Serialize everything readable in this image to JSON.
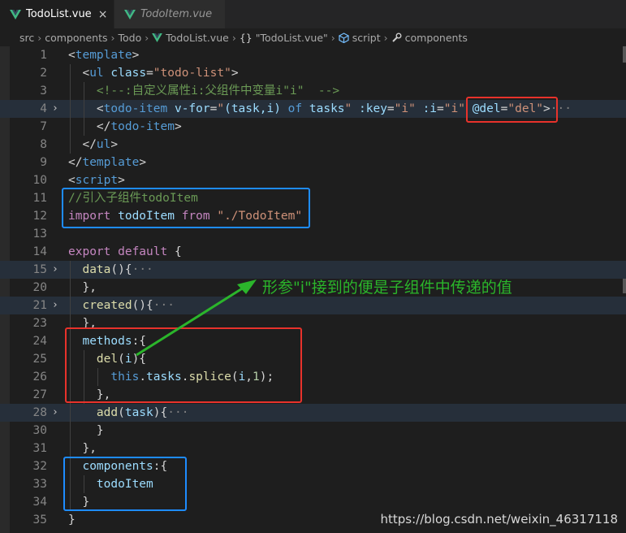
{
  "tabs": [
    {
      "label": "TodoList.vue",
      "close": "×"
    },
    {
      "label": "TodoItem.vue"
    }
  ],
  "breadcrumb": {
    "items": [
      "src",
      "components",
      "Todo",
      "TodoList.vue",
      "\"TodoList.vue\"",
      "script",
      "components"
    ],
    "brace": "{}"
  },
  "code_lines": [
    {
      "n": "1",
      "f": "",
      "tok": [
        [
          "t-pun",
          "<"
        ],
        [
          "t-tag",
          "template"
        ],
        [
          "t-pun",
          ">"
        ]
      ]
    },
    {
      "n": "2",
      "f": "",
      "tok": [
        [
          "t-pun",
          "  <"
        ],
        [
          "t-tag",
          "ul "
        ],
        [
          "t-attr",
          "class"
        ],
        [
          "t-pun",
          "="
        ],
        [
          "t-str",
          "\"todo-list\""
        ],
        [
          "t-pun",
          ">"
        ]
      ]
    },
    {
      "n": "3",
      "f": "",
      "tok": [
        [
          "t-com",
          "    <!--:自定义属性i:父组件中变量i\"i\"  -->"
        ]
      ]
    },
    {
      "n": "4",
      "f": "›",
      "hl": true,
      "tok": [
        [
          "t-pun",
          "    <"
        ],
        [
          "t-tag",
          "todo-item "
        ],
        [
          "t-attr",
          "v-for"
        ],
        [
          "t-pun",
          "="
        ],
        [
          "t-str",
          "\""
        ],
        [
          "t-var",
          "(task,i) "
        ],
        [
          "t-kw",
          "of "
        ],
        [
          "t-var",
          "tasks"
        ],
        [
          "t-str",
          "\" "
        ],
        [
          "t-attr",
          ":key"
        ],
        [
          "t-pun",
          "="
        ],
        [
          "t-str",
          "\"i\" "
        ],
        [
          "t-attr",
          ":i"
        ],
        [
          "t-pun",
          "="
        ],
        [
          "t-str",
          "\"i\" "
        ],
        [
          "t-attr",
          "@del"
        ],
        [
          "t-pun",
          "="
        ],
        [
          "t-str",
          "\"del\""
        ],
        [
          "t-pun",
          ">"
        ],
        [
          "t-gray",
          "···"
        ]
      ]
    },
    {
      "n": "7",
      "f": "",
      "tok": [
        [
          "t-pun",
          "    </"
        ],
        [
          "t-tag",
          "todo-item"
        ],
        [
          "t-pun",
          ">"
        ]
      ]
    },
    {
      "n": "8",
      "f": "",
      "tok": [
        [
          "t-pun",
          "  </"
        ],
        [
          "t-tag",
          "ul"
        ],
        [
          "t-pun",
          ">"
        ]
      ]
    },
    {
      "n": "9",
      "f": "",
      "tok": [
        [
          "t-pun",
          "</"
        ],
        [
          "t-tag",
          "template"
        ],
        [
          "t-pun",
          ">"
        ]
      ]
    },
    {
      "n": "10",
      "f": "",
      "tok": [
        [
          "t-pun",
          "<"
        ],
        [
          "t-tag",
          "script"
        ],
        [
          "t-pun",
          ">"
        ]
      ]
    },
    {
      "n": "11",
      "f": "",
      "tok": [
        [
          "t-com",
          "//引入子组件todoItem"
        ]
      ]
    },
    {
      "n": "12",
      "f": "",
      "tok": [
        [
          "t-kw2",
          "import "
        ],
        [
          "t-var",
          "todoItem "
        ],
        [
          "t-kw2",
          "from "
        ],
        [
          "t-str",
          "\"./TodoItem\""
        ]
      ]
    },
    {
      "n": "13",
      "f": "",
      "tok": []
    },
    {
      "n": "14",
      "f": "",
      "tok": [
        [
          "t-kw2",
          "export "
        ],
        [
          "t-kw2",
          "default "
        ],
        [
          "t-pun",
          "{"
        ]
      ]
    },
    {
      "n": "15",
      "f": "›",
      "hl": true,
      "tok": [
        [
          "t-fn",
          "  data"
        ],
        [
          "t-pun",
          "(){"
        ],
        [
          "t-gray",
          "···"
        ]
      ]
    },
    {
      "n": "20",
      "f": "",
      "tok": [
        [
          "t-pun",
          "  },"
        ]
      ]
    },
    {
      "n": "21",
      "f": "›",
      "hl": true,
      "tok": [
        [
          "t-fn",
          "  created"
        ],
        [
          "t-pun",
          "(){"
        ],
        [
          "t-gray",
          "···"
        ]
      ]
    },
    {
      "n": "23",
      "f": "",
      "tok": [
        [
          "t-pun",
          "  },"
        ]
      ]
    },
    {
      "n": "24",
      "f": "",
      "tok": [
        [
          "t-var",
          "  methods"
        ],
        [
          "t-pun",
          ":{"
        ]
      ]
    },
    {
      "n": "25",
      "f": "",
      "tok": [
        [
          "t-fn",
          "    del"
        ],
        [
          "t-pun",
          "("
        ],
        [
          "t-var",
          "i"
        ],
        [
          "t-pun",
          "){"
        ]
      ]
    },
    {
      "n": "26",
      "f": "",
      "tok": [
        [
          "t-kw",
          "      this"
        ],
        [
          "t-pun",
          "."
        ],
        [
          "t-var",
          "tasks"
        ],
        [
          "t-pun",
          "."
        ],
        [
          "t-fn",
          "splice"
        ],
        [
          "t-pun",
          "("
        ],
        [
          "t-var",
          "i"
        ],
        [
          "t-pun",
          ","
        ],
        [
          "t-num",
          "1"
        ],
        [
          "t-pun",
          ");"
        ]
      ]
    },
    {
      "n": "27",
      "f": "",
      "tok": [
        [
          "t-pun",
          "    },"
        ]
      ]
    },
    {
      "n": "28",
      "f": "›",
      "hl": true,
      "tok": [
        [
          "t-fn",
          "    add"
        ],
        [
          "t-pun",
          "("
        ],
        [
          "t-var",
          "task"
        ],
        [
          "t-pun",
          "){"
        ],
        [
          "t-gray",
          "···"
        ]
      ]
    },
    {
      "n": "30",
      "f": "",
      "tok": [
        [
          "t-pun",
          "    }"
        ]
      ]
    },
    {
      "n": "31",
      "f": "",
      "tok": [
        [
          "t-pun",
          "  },"
        ]
      ]
    },
    {
      "n": "32",
      "f": "",
      "tok": [
        [
          "t-var",
          "  components"
        ],
        [
          "t-pun",
          ":{"
        ]
      ]
    },
    {
      "n": "33",
      "f": "",
      "tok": [
        [
          "t-var",
          "    todoItem"
        ]
      ]
    },
    {
      "n": "34",
      "f": "",
      "tok": [
        [
          "t-pun",
          "  }"
        ]
      ]
    },
    {
      "n": "35",
      "f": "",
      "tok": [
        [
          "t-pun",
          "}"
        ]
      ]
    }
  ],
  "annotation": "形参\"i\"接到的便是子组件中传递的值",
  "watermark": "https://blog.csdn.net/weixin_46317118",
  "colors": {
    "red_box": "#e8322b",
    "blue_box": "#1e8cff",
    "arrow": "#2bb52b",
    "vue": "#41b883"
  }
}
